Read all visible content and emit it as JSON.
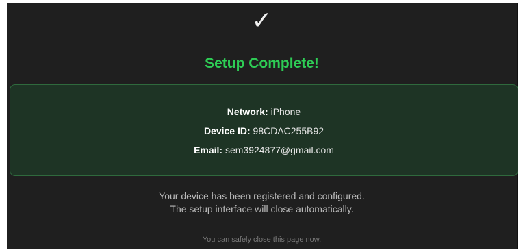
{
  "status": {
    "icon": "checkmark-icon",
    "icon_glyph": "✓",
    "title": "Setup Complete!",
    "title_color": "#2ecc55"
  },
  "details": {
    "network_label": "Network:",
    "network_value": "iPhone",
    "device_label": "Device ID:",
    "device_value": "98CDAC255B92",
    "email_label": "Email:",
    "email_value": "sem3924877@gmail.com"
  },
  "message": {
    "line1": "Your device has been registered and configured.",
    "line2": "The setup interface will close automatically."
  },
  "footer": {
    "note": "You can safely close this page now."
  }
}
